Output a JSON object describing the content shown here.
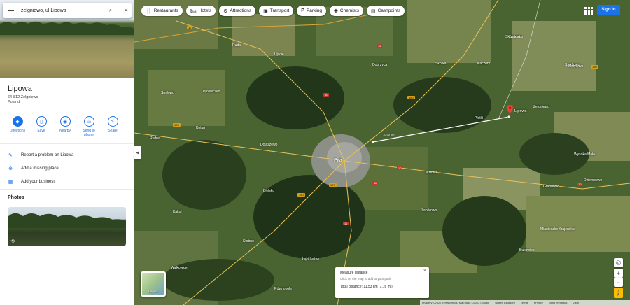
{
  "search": {
    "query": "zelgniewo, ul Lipowa"
  },
  "place": {
    "name": "Lipowa",
    "address_lines": [
      "64-812 Zelgniewo",
      "Poland"
    ]
  },
  "actions": [
    {
      "label": "Directions"
    },
    {
      "label": "Save"
    },
    {
      "label": "Nearby"
    },
    {
      "label": "Send to",
      "label2": "phone"
    },
    {
      "label": "Share"
    }
  ],
  "links": [
    {
      "label": "Report a problem on Lipowa"
    },
    {
      "label": "Add a missing place"
    },
    {
      "label": "Add your business"
    }
  ],
  "photos_heading": "Photos",
  "chips": [
    "Restaurants",
    "Hotels",
    "Attractions",
    "Transport",
    "Parking",
    "Chemists",
    "Cashpoints"
  ],
  "signin": "Sign in",
  "pin_label": "Lipowa",
  "measure": {
    "title": "Measure distance",
    "hint": "Click on the map to add to your path",
    "total": "Total distance: 11.53 km (7.16 mi)"
  },
  "layers_label": "Layers",
  "footer": [
    "Imagery ©2022 TerraMetrics, Map data ©2022 Google",
    "United Kingdom",
    "Terms",
    "Privacy",
    "Send feedback",
    "2 km"
  ],
  "map_labels": [
    "Piła",
    "Dobrzyca",
    "Skórka",
    "Krajenka",
    "Kaczory",
    "Zelgniewo",
    "Szydłowo",
    "Ujście",
    "Miasteczko Krajeńskie",
    "Wysoka Mała",
    "Dolaszewo",
    "Stobno",
    "Wałkowice",
    "Jeziorki",
    "Zabórowo",
    "Grabówno",
    "Płotki",
    "Dziembowo",
    "Kotuń",
    "Bielsko",
    "Rudna",
    "Łąki Leśne",
    "Równopole",
    "Prosieczko",
    "Bukowiec",
    "Motylewo",
    "Skrzatusz",
    "Ruda",
    "Kąkol",
    "Śmiłowo"
  ],
  "distance_labels": [
    "10.90 km"
  ]
}
